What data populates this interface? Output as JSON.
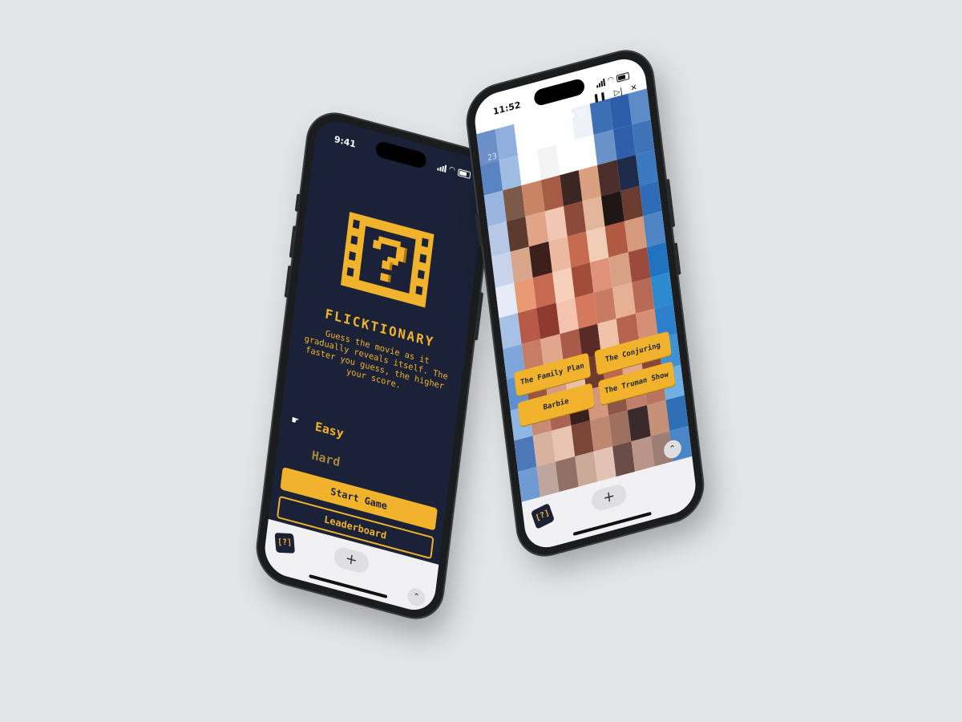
{
  "phone_start": {
    "time": "9:41",
    "title": "FLICKTIONARY",
    "description": "Guess the movie as it gradually reveals itself. The faster you guess, the higher your score.",
    "difficulty": [
      {
        "label": "Easy",
        "selected": true
      },
      {
        "label": "Hard",
        "selected": false
      }
    ],
    "start_label": "Start Game",
    "leaderboard_label": "Leaderboard",
    "browser": {
      "new_tab": "+",
      "expand": "⌃",
      "favicon": "[?]"
    }
  },
  "phone_game": {
    "time": "11:52",
    "hearts": "♥♥♥♥♡",
    "timer": "23",
    "controls": {
      "pause": "❚❚",
      "skip": "▷|",
      "close": "✕"
    },
    "answers": [
      "The Family Plan",
      "The Conjuring",
      "Barbie",
      "The Truman Show"
    ],
    "browser": {
      "new_tab": "+",
      "expand": "⌃",
      "favicon": "[?]"
    }
  },
  "colors": {
    "accent": "#f1b32b",
    "navy": "#1b2237",
    "mosaic": [
      "#6b8fc9",
      "#8fb0de",
      "#ffffff",
      "#ffffff",
      "#ffffff",
      "#eef2f8",
      "#3d6fb4",
      "#2d5ea9",
      "#5c8cc8",
      "#5a83c4",
      "#9fbde3",
      "#ffffff",
      "#f3f3f3",
      "#ffffff",
      "#ffffff",
      "#6a92c8",
      "#2f5fa8",
      "#3f73b8",
      "#9ab6e0",
      "#7c5a4a",
      "#c98466",
      "#a65b44",
      "#3b2622",
      "#d8a07f",
      "#4b2f2a",
      "#1e2a4a",
      "#3c78bd",
      "#b7c8e6",
      "#5b3a30",
      "#e0a486",
      "#f0c7b0",
      "#8b4a3a",
      "#e3b59a",
      "#201616",
      "#6a3c30",
      "#2d6db5",
      "#c8d3ec",
      "#d9a58b",
      "#3d1f1c",
      "#ecb89f",
      "#c46b50",
      "#f2cdb6",
      "#b05a44",
      "#d59a7e",
      "#4d84c4",
      "#e6ecf7",
      "#e89a75",
      "#c76a52",
      "#f6d0bb",
      "#a24c3a",
      "#e0937a",
      "#d8a086",
      "#9a4b3b",
      "#1f73c0",
      "#a6c0e6",
      "#b85a47",
      "#8c3a2e",
      "#f3c3ad",
      "#d4785e",
      "#c87a62",
      "#e7b096",
      "#b96a55",
      "#2c8ad0",
      "#7fa6da",
      "#c77c66",
      "#e1a68e",
      "#a95a48",
      "#5a2a26",
      "#f1c2a8",
      "#b56450",
      "#d58f75",
      "#2d80c9",
      "#5e8fce",
      "#9a5544",
      "#d79b84",
      "#eac0ab",
      "#6d3a30",
      "#b96852",
      "#e6a68b",
      "#8a4538",
      "#3f93d4",
      "#8fb7e4",
      "#c78a74",
      "#a86450",
      "#3a1f1c",
      "#d3967e",
      "#8e5646",
      "#c0806a",
      "#b97460",
      "#6fb0e0",
      "#4c78b8",
      "#d9b29f",
      "#e9c3b1",
      "#7b4537",
      "#bd8772",
      "#a0705f",
      "#3b2a2c",
      "#c68f78",
      "#2f6fb5",
      "#6f9bd3",
      "#bfa59b",
      "#8f6f66",
      "#caa999",
      "#e1c2b3",
      "#6a4d47",
      "#b99587",
      "#9d7e74",
      "#4a86c6"
    ]
  }
}
